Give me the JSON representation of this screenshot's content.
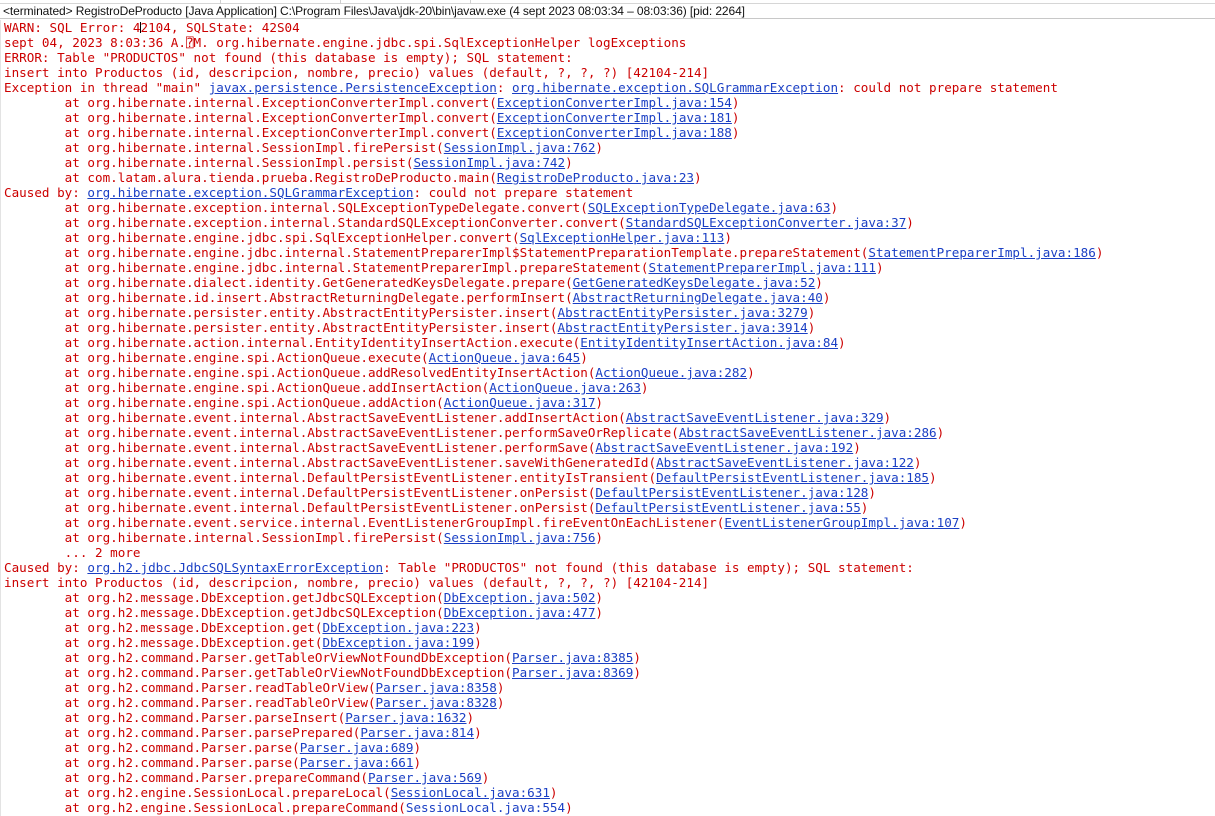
{
  "window": {
    "title": "<terminated> RegistroDeProducto [Java Application] C:\\Program Files\\Java\\jdk-20\\bin\\javaw.exe  (4 sept 2023 08:03:34 – 08:03:36) [pid: 2264]",
    "app_name": "RegistroDeProducto",
    "launch_type": "Java Application",
    "jvm_path": "C:\\Program Files\\Java\\jdk-20\\bin\\javaw.exe",
    "time_range": "4 sept 2023 08:03:34 – 08:03:36",
    "pid": "2264",
    "status": "<terminated>"
  },
  "colors": {
    "error_text": "#cc0000",
    "link_text": "#1a3fc4",
    "background": "#ffffff",
    "titlebar_text": "#111111"
  },
  "console": {
    "lines": [
      {
        "segments": [
          {
            "t": "WARN: SQL Error: 4"
          },
          {
            "caret": true
          },
          {
            "t": "2104, SQLState: 42S04"
          }
        ]
      },
      {
        "segments": [
          {
            "t": "sept 04, 2023 8:03:36 A.⍰M. org.hibernate.engine.jdbc.spi.SqlExceptionHelper logExceptions"
          }
        ]
      },
      {
        "segments": [
          {
            "t": "ERROR: Table \"PRODUCTOS\" not found (this database is empty); SQL statement:"
          }
        ]
      },
      {
        "segments": [
          {
            "t": "insert into Productos (id, descripcion, nombre, precio) values (default, ?, ?, ?) [42104-214]"
          }
        ]
      },
      {
        "segments": [
          {
            "t": "Exception in thread \"main\" "
          },
          {
            "t": "javax.persistence.PersistenceException",
            "link": true
          },
          {
            "t": ": "
          },
          {
            "t": "org.hibernate.exception.SQLGrammarException",
            "link": true
          },
          {
            "t": ": could not prepare statement"
          }
        ]
      },
      {
        "segments": [
          {
            "t": "        at org.hibernate.internal.ExceptionConverterImpl.convert("
          },
          {
            "t": "ExceptionConverterImpl.java:154",
            "link": true
          },
          {
            "t": ")"
          }
        ]
      },
      {
        "segments": [
          {
            "t": "        at org.hibernate.internal.ExceptionConverterImpl.convert("
          },
          {
            "t": "ExceptionConverterImpl.java:181",
            "link": true
          },
          {
            "t": ")"
          }
        ]
      },
      {
        "segments": [
          {
            "t": "        at org.hibernate.internal.ExceptionConverterImpl.convert("
          },
          {
            "t": "ExceptionConverterImpl.java:188",
            "link": true
          },
          {
            "t": ")"
          }
        ]
      },
      {
        "segments": [
          {
            "t": "        at org.hibernate.internal.SessionImpl.firePersist("
          },
          {
            "t": "SessionImpl.java:762",
            "link": true
          },
          {
            "t": ")"
          }
        ]
      },
      {
        "segments": [
          {
            "t": "        at org.hibernate.internal.SessionImpl.persist("
          },
          {
            "t": "SessionImpl.java:742",
            "link": true
          },
          {
            "t": ")"
          }
        ]
      },
      {
        "segments": [
          {
            "t": "        at com.latam.alura.tienda.prueba.RegistroDeProducto.main("
          },
          {
            "t": "RegistroDeProducto.java:23",
            "link": true
          },
          {
            "t": ")"
          }
        ]
      },
      {
        "segments": [
          {
            "t": "Caused by: "
          },
          {
            "t": "org.hibernate.exception.SQLGrammarException",
            "link": true
          },
          {
            "t": ": could not prepare statement"
          }
        ]
      },
      {
        "segments": [
          {
            "t": "        at org.hibernate.exception.internal.SQLExceptionTypeDelegate.convert("
          },
          {
            "t": "SQLExceptionTypeDelegate.java:63",
            "link": true
          },
          {
            "t": ")"
          }
        ]
      },
      {
        "segments": [
          {
            "t": "        at org.hibernate.exception.internal.StandardSQLExceptionConverter.convert("
          },
          {
            "t": "StandardSQLExceptionConverter.java:37",
            "link": true
          },
          {
            "t": ")"
          }
        ]
      },
      {
        "segments": [
          {
            "t": "        at org.hibernate.engine.jdbc.spi.SqlExceptionHelper.convert("
          },
          {
            "t": "SqlExceptionHelper.java:113",
            "link": true
          },
          {
            "t": ")"
          }
        ]
      },
      {
        "segments": [
          {
            "t": "        at org.hibernate.engine.jdbc.internal.StatementPreparerImpl$StatementPreparationTemplate.prepareStatement("
          },
          {
            "t": "StatementPreparerImpl.java:186",
            "link": true
          },
          {
            "t": ")"
          }
        ]
      },
      {
        "segments": [
          {
            "t": "        at org.hibernate.engine.jdbc.internal.StatementPreparerImpl.prepareStatement("
          },
          {
            "t": "StatementPreparerImpl.java:111",
            "link": true
          },
          {
            "t": ")"
          }
        ]
      },
      {
        "segments": [
          {
            "t": "        at org.hibernate.dialect.identity.GetGeneratedKeysDelegate.prepare("
          },
          {
            "t": "GetGeneratedKeysDelegate.java:52",
            "link": true
          },
          {
            "t": ")"
          }
        ]
      },
      {
        "segments": [
          {
            "t": "        at org.hibernate.id.insert.AbstractReturningDelegate.performInsert("
          },
          {
            "t": "AbstractReturningDelegate.java:40",
            "link": true
          },
          {
            "t": ")"
          }
        ]
      },
      {
        "segments": [
          {
            "t": "        at org.hibernate.persister.entity.AbstractEntityPersister.insert("
          },
          {
            "t": "AbstractEntityPersister.java:3279",
            "link": true
          },
          {
            "t": ")"
          }
        ]
      },
      {
        "segments": [
          {
            "t": "        at org.hibernate.persister.entity.AbstractEntityPersister.insert("
          },
          {
            "t": "AbstractEntityPersister.java:3914",
            "link": true
          },
          {
            "t": ")"
          }
        ]
      },
      {
        "segments": [
          {
            "t": "        at org.hibernate.action.internal.EntityIdentityInsertAction.execute("
          },
          {
            "t": "EntityIdentityInsertAction.java:84",
            "link": true
          },
          {
            "t": ")"
          }
        ]
      },
      {
        "segments": [
          {
            "t": "        at org.hibernate.engine.spi.ActionQueue.execute("
          },
          {
            "t": "ActionQueue.java:645",
            "link": true
          },
          {
            "t": ")"
          }
        ]
      },
      {
        "segments": [
          {
            "t": "        at org.hibernate.engine.spi.ActionQueue.addResolvedEntityInsertAction("
          },
          {
            "t": "ActionQueue.java:282",
            "link": true
          },
          {
            "t": ")"
          }
        ]
      },
      {
        "segments": [
          {
            "t": "        at org.hibernate.engine.spi.ActionQueue.addInsertAction("
          },
          {
            "t": "ActionQueue.java:263",
            "link": true
          },
          {
            "t": ")"
          }
        ]
      },
      {
        "segments": [
          {
            "t": "        at org.hibernate.engine.spi.ActionQueue.addAction("
          },
          {
            "t": "ActionQueue.java:317",
            "link": true
          },
          {
            "t": ")"
          }
        ]
      },
      {
        "segments": [
          {
            "t": "        at org.hibernate.event.internal.AbstractSaveEventListener.addInsertAction("
          },
          {
            "t": "AbstractSaveEventListener.java:329",
            "link": true
          },
          {
            "t": ")"
          }
        ]
      },
      {
        "segments": [
          {
            "t": "        at org.hibernate.event.internal.AbstractSaveEventListener.performSaveOrReplicate("
          },
          {
            "t": "AbstractSaveEventListener.java:286",
            "link": true
          },
          {
            "t": ")"
          }
        ]
      },
      {
        "segments": [
          {
            "t": "        at org.hibernate.event.internal.AbstractSaveEventListener.performSave("
          },
          {
            "t": "AbstractSaveEventListener.java:192",
            "link": true
          },
          {
            "t": ")"
          }
        ]
      },
      {
        "segments": [
          {
            "t": "        at org.hibernate.event.internal.AbstractSaveEventListener.saveWithGeneratedId("
          },
          {
            "t": "AbstractSaveEventListener.java:122",
            "link": true
          },
          {
            "t": ")"
          }
        ]
      },
      {
        "segments": [
          {
            "t": "        at org.hibernate.event.internal.DefaultPersistEventListener.entityIsTransient("
          },
          {
            "t": "DefaultPersistEventListener.java:185",
            "link": true
          },
          {
            "t": ")"
          }
        ]
      },
      {
        "segments": [
          {
            "t": "        at org.hibernate.event.internal.DefaultPersistEventListener.onPersist("
          },
          {
            "t": "DefaultPersistEventListener.java:128",
            "link": true
          },
          {
            "t": ")"
          }
        ]
      },
      {
        "segments": [
          {
            "t": "        at org.hibernate.event.internal.DefaultPersistEventListener.onPersist("
          },
          {
            "t": "DefaultPersistEventListener.java:55",
            "link": true
          },
          {
            "t": ")"
          }
        ]
      },
      {
        "segments": [
          {
            "t": "        at org.hibernate.event.service.internal.EventListenerGroupImpl.fireEventOnEachListener("
          },
          {
            "t": "EventListenerGroupImpl.java:107",
            "link": true
          },
          {
            "t": ")"
          }
        ]
      },
      {
        "segments": [
          {
            "t": "        at org.hibernate.internal.SessionImpl.firePersist("
          },
          {
            "t": "SessionImpl.java:756",
            "link": true
          },
          {
            "t": ")"
          }
        ]
      },
      {
        "segments": [
          {
            "t": "        ... 2 more"
          }
        ]
      },
      {
        "segments": [
          {
            "t": "Caused by: "
          },
          {
            "t": "org.h2.jdbc.JdbcSQLSyntaxErrorException",
            "link": true
          },
          {
            "t": ": Table \"PRODUCTOS\" not found (this database is empty); SQL statement:"
          }
        ]
      },
      {
        "segments": [
          {
            "t": "insert into Productos (id, descripcion, nombre, precio) values (default, ?, ?, ?) [42104-214]"
          }
        ]
      },
      {
        "segments": [
          {
            "t": "        at org.h2.message.DbException.getJdbcSQLException("
          },
          {
            "t": "DbException.java:502",
            "link": true
          },
          {
            "t": ")"
          }
        ]
      },
      {
        "segments": [
          {
            "t": "        at org.h2.message.DbException.getJdbcSQLException("
          },
          {
            "t": "DbException.java:477",
            "link": true
          },
          {
            "t": ")"
          }
        ]
      },
      {
        "segments": [
          {
            "t": "        at org.h2.message.DbException.get("
          },
          {
            "t": "DbException.java:223",
            "link": true
          },
          {
            "t": ")"
          }
        ]
      },
      {
        "segments": [
          {
            "t": "        at org.h2.message.DbException.get("
          },
          {
            "t": "DbException.java:199",
            "link": true
          },
          {
            "t": ")"
          }
        ]
      },
      {
        "segments": [
          {
            "t": "        at org.h2.command.Parser.getTableOrViewNotFoundDbException("
          },
          {
            "t": "Parser.java:8385",
            "link": true
          },
          {
            "t": ")"
          }
        ]
      },
      {
        "segments": [
          {
            "t": "        at org.h2.command.Parser.getTableOrViewNotFoundDbException("
          },
          {
            "t": "Parser.java:8369",
            "link": true
          },
          {
            "t": ")"
          }
        ]
      },
      {
        "segments": [
          {
            "t": "        at org.h2.command.Parser.readTableOrView("
          },
          {
            "t": "Parser.java:8358",
            "link": true
          },
          {
            "t": ")"
          }
        ]
      },
      {
        "segments": [
          {
            "t": "        at org.h2.command.Parser.readTableOrView("
          },
          {
            "t": "Parser.java:8328",
            "link": true
          },
          {
            "t": ")"
          }
        ]
      },
      {
        "segments": [
          {
            "t": "        at org.h2.command.Parser.parseInsert("
          },
          {
            "t": "Parser.java:1632",
            "link": true
          },
          {
            "t": ")"
          }
        ]
      },
      {
        "segments": [
          {
            "t": "        at org.h2.command.Parser.parsePrepared("
          },
          {
            "t": "Parser.java:814",
            "link": true
          },
          {
            "t": ")"
          }
        ]
      },
      {
        "segments": [
          {
            "t": "        at org.h2.command.Parser.parse("
          },
          {
            "t": "Parser.java:689",
            "link": true
          },
          {
            "t": ")"
          }
        ]
      },
      {
        "segments": [
          {
            "t": "        at org.h2.command.Parser.parse("
          },
          {
            "t": "Parser.java:661",
            "link": true
          },
          {
            "t": ")"
          }
        ]
      },
      {
        "segments": [
          {
            "t": "        at org.h2.command.Parser.prepareCommand("
          },
          {
            "t": "Parser.java:569",
            "link": true
          },
          {
            "t": ")"
          }
        ]
      },
      {
        "segments": [
          {
            "t": "        at org.h2.engine.SessionLocal.prepareLocal("
          },
          {
            "t": "SessionLocal.java:631",
            "link": true
          },
          {
            "t": ")"
          }
        ]
      },
      {
        "segments": [
          {
            "t": "        at org.h2.engine.SessionLocal.prepareCommand("
          },
          {
            "t": "SessionLocal.java:554",
            "link": true,
            "nounderline": true
          },
          {
            "t": ")"
          }
        ]
      }
    ]
  }
}
